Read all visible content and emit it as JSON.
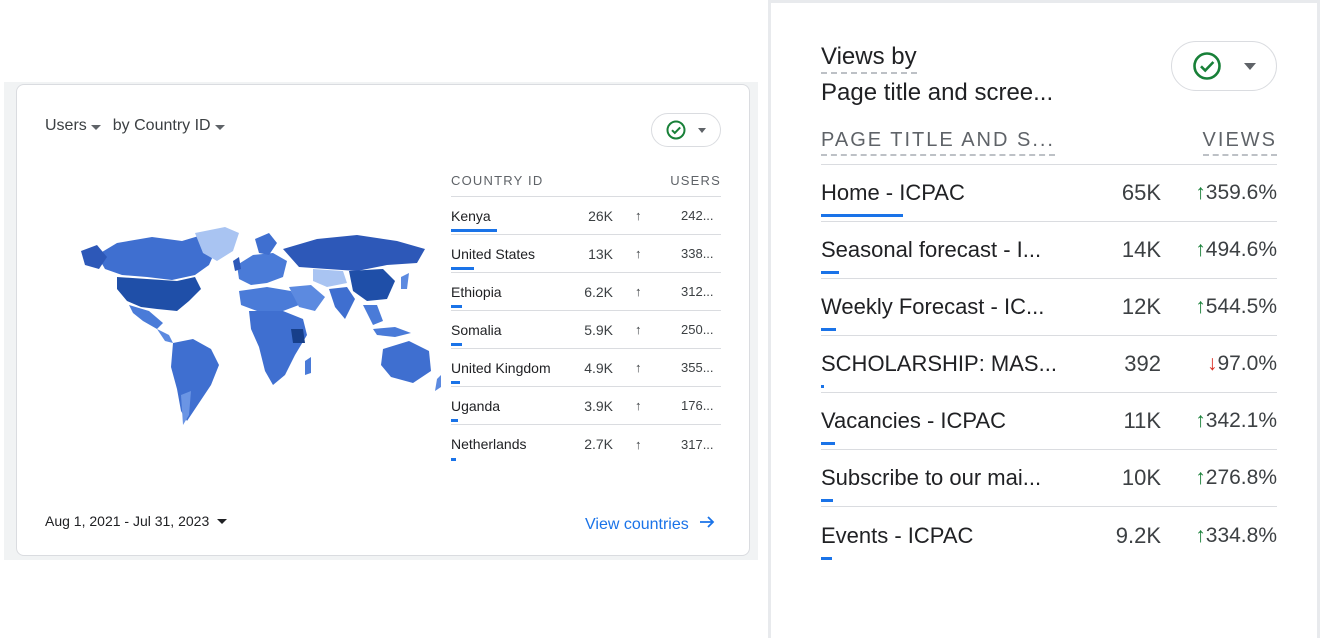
{
  "colors": {
    "accent": "#1a73e8",
    "up": "#188038",
    "down": "#d93025",
    "check": "#188038"
  },
  "left_card": {
    "metric": "Users",
    "dimension": "by Country ID",
    "status_icon": "check-circle-icon",
    "table": {
      "col_country": "COUNTRY ID",
      "col_users": "USERS",
      "rows": [
        {
          "country": "Kenya",
          "users": "26K",
          "delta": "242...",
          "share": 1.0
        },
        {
          "country": "United States",
          "users": "13K",
          "delta": "338...",
          "share": 0.5
        },
        {
          "country": "Ethiopia",
          "users": "6.2K",
          "delta": "312...",
          "share": 0.24
        },
        {
          "country": "Somalia",
          "users": "5.9K",
          "delta": "250...",
          "share": 0.23
        },
        {
          "country": "United Kingdom",
          "users": "4.9K",
          "delta": "355...",
          "share": 0.19
        },
        {
          "country": "Uganda",
          "users": "3.9K",
          "delta": "176...",
          "share": 0.15
        },
        {
          "country": "Netherlands",
          "users": "2.7K",
          "delta": "317...",
          "share": 0.1
        }
      ]
    },
    "date_range": "Aug 1, 2021 - Jul 31, 2023",
    "view_link": "View countries"
  },
  "right_card": {
    "title_line1": "Views by",
    "title_line2": "Page title and scree...",
    "status_icon": "check-circle-icon",
    "table": {
      "col_page": "PAGE TITLE AND S...",
      "col_views": "VIEWS",
      "rows": [
        {
          "page": "Home - ICPAC",
          "views": "65K",
          "delta": "359.6%",
          "direction": "up",
          "share": 1.0
        },
        {
          "page": "Seasonal forecast - I...",
          "views": "14K",
          "delta": "494.6%",
          "direction": "up",
          "share": 0.22
        },
        {
          "page": "Weekly Forecast - IC...",
          "views": "12K",
          "delta": "544.5%",
          "direction": "up",
          "share": 0.18
        },
        {
          "page": "SCHOLARSHIP: MAS...",
          "views": "392",
          "delta": "97.0%",
          "direction": "down",
          "share": 0.01
        },
        {
          "page": "Vacancies - ICPAC",
          "views": "11K",
          "delta": "342.1%",
          "direction": "up",
          "share": 0.17
        },
        {
          "page": "Subscribe to our mai...",
          "views": "10K",
          "delta": "276.8%",
          "direction": "up",
          "share": 0.15
        },
        {
          "page": "Events - ICPAC",
          "views": "9.2K",
          "delta": "334.8%",
          "direction": "up",
          "share": 0.14
        }
      ]
    }
  }
}
